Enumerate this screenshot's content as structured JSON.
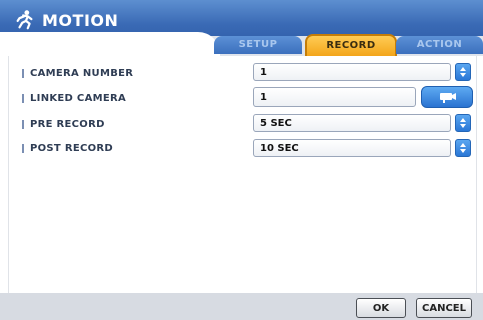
{
  "window": {
    "title": "MOTION",
    "icon": "running-person-icon"
  },
  "tabs": [
    {
      "label": "SETUP",
      "active": false
    },
    {
      "label": "RECORD",
      "active": true
    },
    {
      "label": "ACTION",
      "active": false
    }
  ],
  "fields": {
    "camera_number": {
      "label": "CAMERA NUMBER",
      "value": "1"
    },
    "linked_camera": {
      "label": "LINKED CAMERA",
      "value": "1",
      "button_icon": "camera-icon"
    },
    "pre_record": {
      "label": "PRE RECORD",
      "value": "5 SEC"
    },
    "post_record": {
      "label": "POST RECORD",
      "value": "10 SEC"
    }
  },
  "buttons": {
    "ok": "OK",
    "cancel": "CANCEL"
  },
  "colors": {
    "header": "#3a6ab5",
    "active_tab": "#f3a51a",
    "inactive_tab": "#3b6fbd",
    "spin": "#2a77d6"
  }
}
